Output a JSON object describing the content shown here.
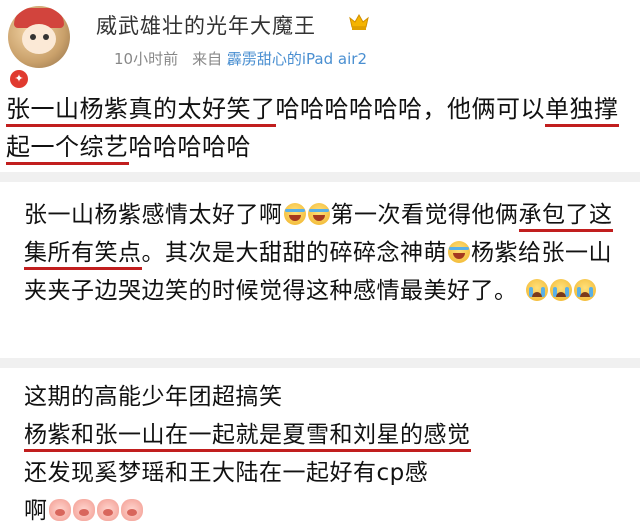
{
  "post": {
    "username": "威武雄壮的光年大魔王",
    "vip_badge_icon": "vip-crown-icon",
    "time": "10小时前",
    "source_prefix": "来自",
    "device": "霹雳甜心的iPad air2",
    "text_part1": "张一山杨紫真的太好笑了",
    "text_part2": "哈哈哈哈哈哈，他俩可以",
    "text_part3": "单独撑起一个综艺",
    "text_part4": "哈哈哈哈哈"
  },
  "comments": [
    {
      "part1": "张一山杨紫感情太好了啊",
      "part2": "第一次看觉得他俩",
      "part3": "承包了这集所有笑点",
      "part4": "。其次是大甜甜的碎碎念神萌",
      "part5": "杨紫给张一山夹夹子边哭边笑的时候觉得这种感情最美好了。"
    },
    {
      "line1": "这期的高能少年团超搞笑",
      "line2": "杨紫和张一山在一起就是夏雪和刘星的感觉",
      "line3": "还发现奚梦瑶和王大陆在一起好有cp感",
      "line4": "啊"
    }
  ],
  "colors": {
    "underline": "#c11e1e",
    "link": "#4a8fd1",
    "meta": "#888888",
    "separator": "#f0f0f0"
  }
}
